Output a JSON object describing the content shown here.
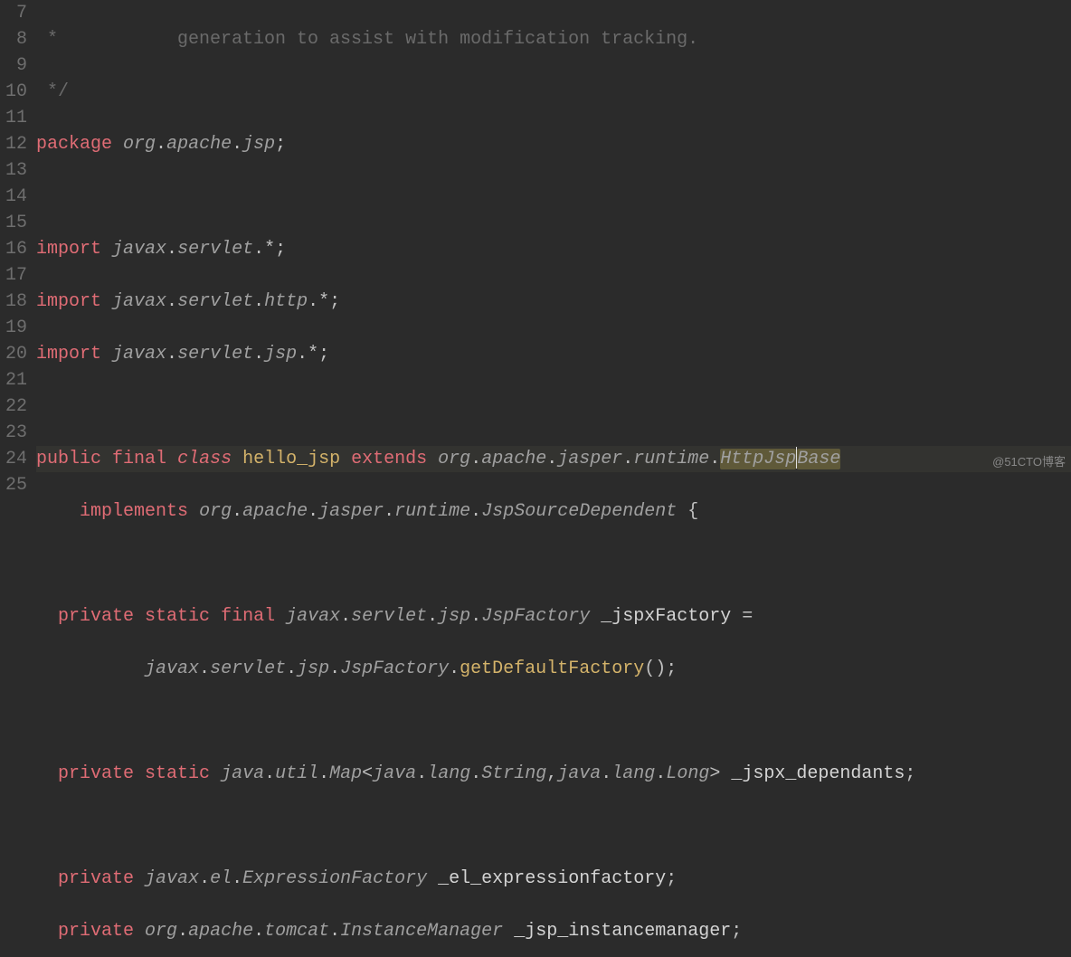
{
  "watermark": "@51CTO博客",
  "gutter": [
    "7",
    "8",
    "9",
    "10",
    "11",
    "12",
    "13",
    "14",
    "15",
    "16",
    "17",
    "18",
    "19",
    "20",
    "21",
    "22",
    "23",
    "24",
    "25"
  ],
  "lines": {
    "l7": {
      "c1": " *           generation to assist with modification tracking."
    },
    "l8": {
      "c1": " */"
    },
    "l9": {
      "k1": "package",
      "p1": "org",
      "d": ".",
      "p2": "apache",
      "p3": "jsp",
      "sc": ";"
    },
    "l11": {
      "k1": "import",
      "p1": "javax",
      "d": ".",
      "p2": "servlet",
      "star": "*",
      "sc": ";"
    },
    "l12": {
      "k1": "import",
      "p1": "javax",
      "d": ".",
      "p2": "servlet",
      "p3": "http",
      "star": "*",
      "sc": ";"
    },
    "l13": {
      "k1": "import",
      "p1": "javax",
      "d": ".",
      "p2": "servlet",
      "p3": "jsp",
      "star": "*",
      "sc": ";"
    },
    "l15": {
      "k1": "public",
      "k2": "final",
      "k3": "class",
      "name": "hello_jsp",
      "k4": "extends",
      "t1": "org",
      "t2": "apache",
      "t3": "jasper",
      "t4": "runtime",
      "t5a": "HttpJsp",
      "t5b": "Base"
    },
    "l16": {
      "k1": "implements",
      "t1": "org",
      "t2": "apache",
      "t3": "jasper",
      "t4": "runtime",
      "t5": "JspSourceDependent",
      "brace": "{"
    },
    "l18": {
      "k1": "private",
      "k2": "static",
      "k3": "final",
      "t1": "javax",
      "t2": "servlet",
      "t3": "jsp",
      "t4": "JspFactory",
      "name": "_jspxFactory",
      "eq": "="
    },
    "l19": {
      "t1": "javax",
      "t2": "servlet",
      "t3": "jsp",
      "t4": "JspFactory",
      "m": "getDefaultFactory",
      "par": "()",
      "sc": ";"
    },
    "l21": {
      "k1": "private",
      "k2": "static",
      "t1": "java",
      "t2": "util",
      "t3": "Map",
      "lt": "<",
      "g1": "java",
      "g2": "lang",
      "g3": "String",
      "cm": ",",
      "g4": "java",
      "g5": "lang",
      "g6": "Long",
      "gt": ">",
      "name": "_jspx_dependants",
      "sc": ";"
    },
    "l23": {
      "k1": "private",
      "t1": "javax",
      "t2": "el",
      "t3": "ExpressionFactory",
      "name": "_el_expressionfactory",
      "sc": ";"
    },
    "l24": {
      "k1": "private",
      "t1": "org",
      "t2": "apache",
      "t3": "tomcat",
      "t4": "InstanceManager",
      "name": "_jsp_instancemanager",
      "sc": ";"
    }
  }
}
